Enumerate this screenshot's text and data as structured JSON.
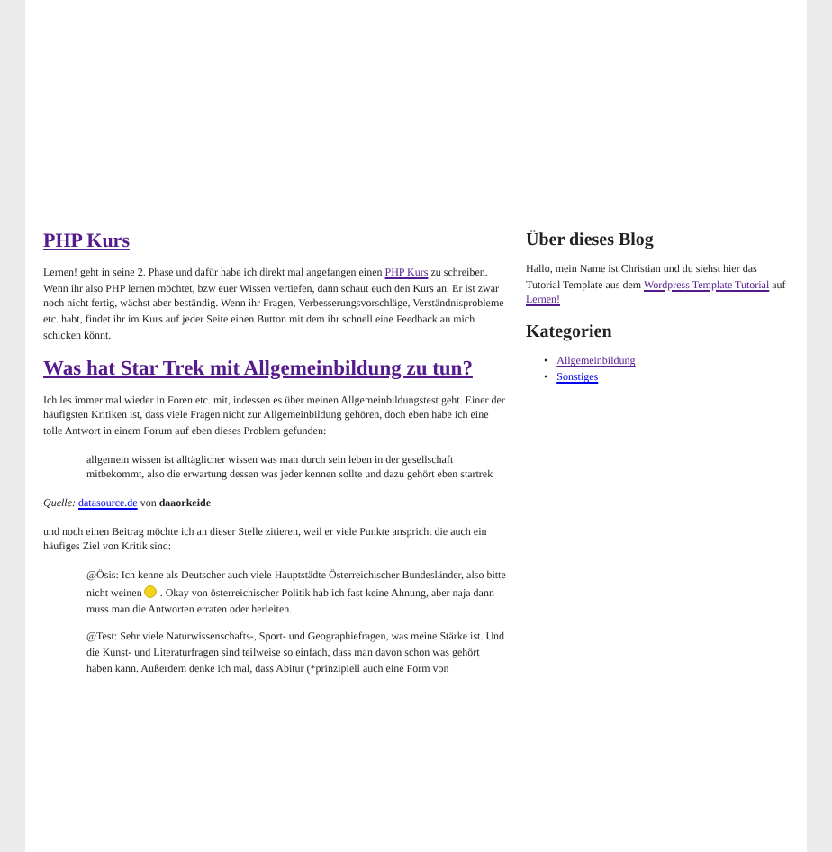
{
  "posts": [
    {
      "title": "PHP Kurs",
      "title_visited": true,
      "blocks": [
        {
          "kind": "paragraph",
          "parts": [
            {
              "kind": "text",
              "text": "Lernen! geht in seine 2. Phase und dafür habe ich direkt mal angefangen einen "
            },
            {
              "kind": "link",
              "text": "PHP Kurs",
              "visited": true
            },
            {
              "kind": "text",
              "text": " zu schreiben. Wenn ihr also PHP lernen möchtet, bzw euer Wissen vertiefen, dann schaut euch den Kurs an. Er ist zwar noch nicht fertig, wächst aber beständig. Wenn ihr Fragen, Verbesserungsvorschläge, Verständnisprobleme etc. habt, findet ihr im Kurs auf jeder Seite einen Button mit dem ihr schnell eine Feedback an mich schicken könnt."
            }
          ]
        }
      ]
    },
    {
      "title": "Was hat Star Trek mit Allgemeinbildung zu tun?",
      "title_visited": true,
      "blocks": [
        {
          "kind": "paragraph",
          "parts": [
            {
              "kind": "text",
              "text": "Ich les immer mal wieder in Foren etc. mit, indessen es über meinen Allgemeinbildungstest geht. Einer der häufigsten Kritiken ist, dass viele Fragen nicht zur Allgemeinbildung gehören, doch eben habe ich eine tolle Antwort in einem Forum auf eben dieses Problem gefunden:"
            }
          ]
        },
        {
          "kind": "quote",
          "paragraphs": [
            {
              "parts": [
                {
                  "kind": "text",
                  "text": "allgemein wissen ist alltäglicher wissen was man durch sein leben in der gesellschaft mitbekommt, also die erwartung dessen was jeder kennen sollte und dazu gehört eben startrek"
                }
              ]
            }
          ]
        },
        {
          "kind": "paragraph",
          "parts": [
            {
              "kind": "text",
              "text": "*Quelle:* "
            },
            {
              "kind": "link",
              "text": "datasource.de",
              "visited": false
            },
            {
              "kind": "text",
              "text": " von **daaorkeide**"
            }
          ]
        },
        {
          "kind": "paragraph",
          "parts": [
            {
              "kind": "text",
              "text": "und noch einen Beitrag möchte ich an dieser Stelle zitieren, weil er viele Punkte anspricht die auch ein häufiges Ziel von Kritik sind:"
            }
          ]
        },
        {
          "kind": "quote",
          "paragraphs": [
            {
              "parts": [
                {
                  "kind": "text",
                  "text": "@Ösis: Ich kenne als Deutscher auch viele Hauptstädte Österreichischer Bundesländer, also bitte nicht weinen "
                },
                {
                  "kind": "smiley"
                },
                {
                  "kind": "text",
                  "text": " . Okay von österreichischer Politik hab ich fast keine Ahnung, aber naja dann muss man die Antworten erraten oder herleiten."
                }
              ]
            },
            {
              "parts": [
                {
                  "kind": "text",
                  "text": "@Test: Sehr viele Naturwissenschafts-, Sport- und Geographiefragen, was meine Stärke ist. Und die Kunst- und Literaturfragen sind teilweise so einfach, dass man davon schon was gehört haben kann. Außerdem denke ich mal, dass Abitur (*prinzipiell auch eine Form von"
                }
              ]
            }
          ]
        }
      ]
    }
  ],
  "sidebar": {
    "about": {
      "title": "Über dieses Blog",
      "parts": [
        {
          "kind": "text",
          "text": "Hallo, mein Name ist Christian und du siehst hier das Tutorial Template aus dem "
        },
        {
          "kind": "link",
          "text": "Wordpress Template Tutorial",
          "visited": true
        },
        {
          "kind": "text",
          "text": " auf "
        },
        {
          "kind": "link",
          "text": "Lernen!",
          "visited": true
        }
      ]
    },
    "categories": {
      "title": "Kategorien",
      "items": [
        {
          "marker": "•",
          "label": "Allgemeinbildung",
          "visited": true
        },
        {
          "marker": "•",
          "label": "Sonstiges",
          "visited": false
        }
      ]
    }
  }
}
